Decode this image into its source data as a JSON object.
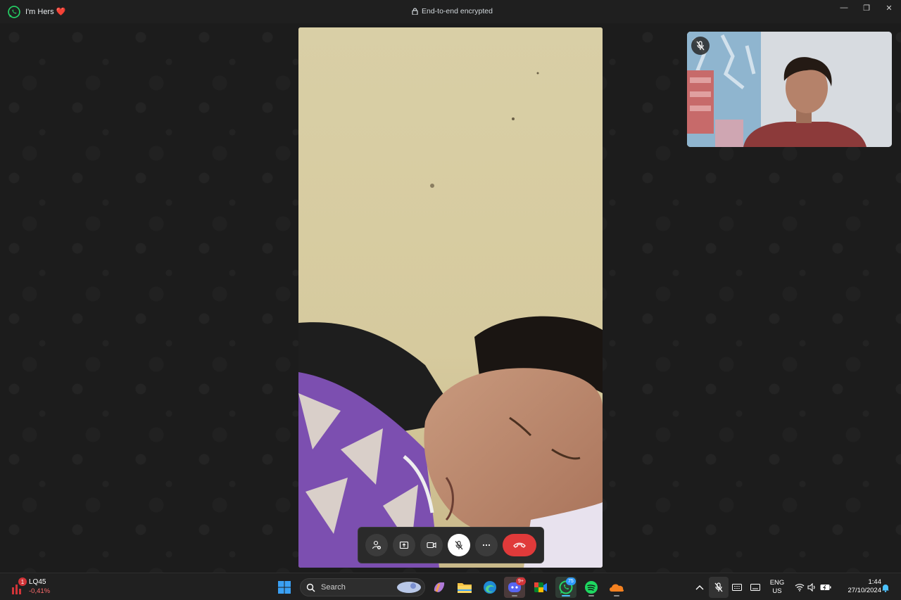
{
  "window": {
    "chat_name": "I'm Hers ❤️",
    "encryption_label": "End-to-end encrypted",
    "minimize": "—",
    "restore": "❐",
    "close": "✕"
  },
  "call": {
    "self_muted": true,
    "controls": [
      "add-participant",
      "share-screen",
      "camera",
      "microphone-muted",
      "more-options",
      "end-call"
    ]
  },
  "taskbar": {
    "widget": {
      "name": "LQ45",
      "value": "-0,41%",
      "badge": "1"
    },
    "search_placeholder": "Search",
    "discord_badge": "9+",
    "whatsapp_badge": "75",
    "language": "ENG",
    "region": "US",
    "time": "1:44",
    "date": "27/10/2024"
  },
  "colors": {
    "end_call": "#e03a3a",
    "whatsapp": "#25d366",
    "accent": "#2f9bff"
  }
}
